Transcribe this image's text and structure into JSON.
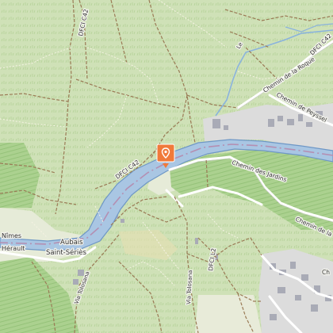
{
  "map": {
    "colors": {
      "land": "#cfe1b7",
      "forest_hatch": "#b7d59b",
      "vineyard": "#a9d08e",
      "field": "#e7ecd9",
      "river": "#a9c6e3",
      "river_edge": "#6d97c6",
      "waterway_line": "#8ab2dc",
      "major_road": "#ffffff",
      "track": "#a0805a",
      "path": "#fffef6",
      "boundary": "#b89ab6",
      "urban": "#d9d9d9",
      "building": "#a9aab5",
      "sand": "#e8e1b8",
      "marker": "#f07a3a"
    },
    "labels": {
      "dfci_c42_north": "DFCI C42",
      "le": "Le",
      "dfci_c42_ne": "DFCI C42",
      "chemin_roque": "Chemin de la Roque",
      "chemin_peyssel": "Chemin de Peyssel",
      "dfci_c42_river": "DFCI C42",
      "chemin_jardins": "Chemin des Jardins",
      "chemin_de_la": "Chemin de la",
      "nimes": "Nîmes",
      "aubais": "Aubais",
      "herault": "Hérault",
      "saint_series": "Saint-Sériès",
      "via_tolosana_left": "Via Tolosana",
      "via_tolosana_right": "Via Tolosana",
      "dfci_l2": "DFCI L2",
      "ch_edge": "Ch"
    },
    "marker": {
      "icon": "location-pin-icon"
    }
  }
}
